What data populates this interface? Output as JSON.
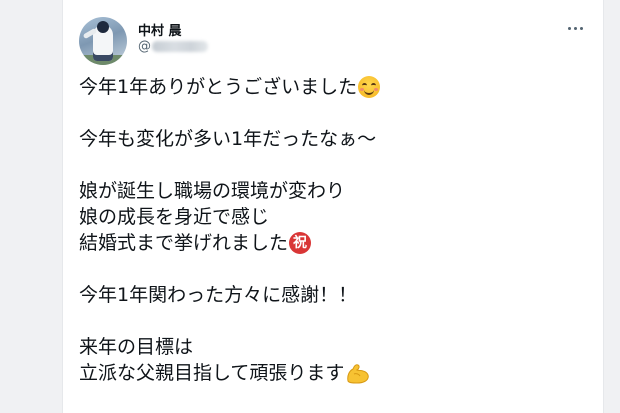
{
  "tweet": {
    "author_name": "中村 晨",
    "handle_prefix": "@",
    "lines": [
      "今年1年ありがとうございました",
      "",
      "今年も変化が多い1年だったなぁ〜",
      "",
      "娘が誕生し職場の環境が変わり",
      "娘の成長を身近で感じ",
      "結婚式まで挙げれました",
      "",
      "今年1年関わった方々に感謝！！",
      "",
      "来年の目標は",
      "立派な父親目指して頑張ります"
    ],
    "emoji": {
      "line1": "smiling-face-emoji",
      "line7": "celebration-kanji-emoji",
      "line7_char": "祝",
      "line12": "flexed-biceps-emoji"
    }
  },
  "colors": {
    "text": "#0f1419",
    "secondary": "#536471",
    "card_bg": "#ffffff",
    "page_bg": "#f0f1f3",
    "iwai_red": "#d93636",
    "muscle_yellow": "#f7c233"
  }
}
